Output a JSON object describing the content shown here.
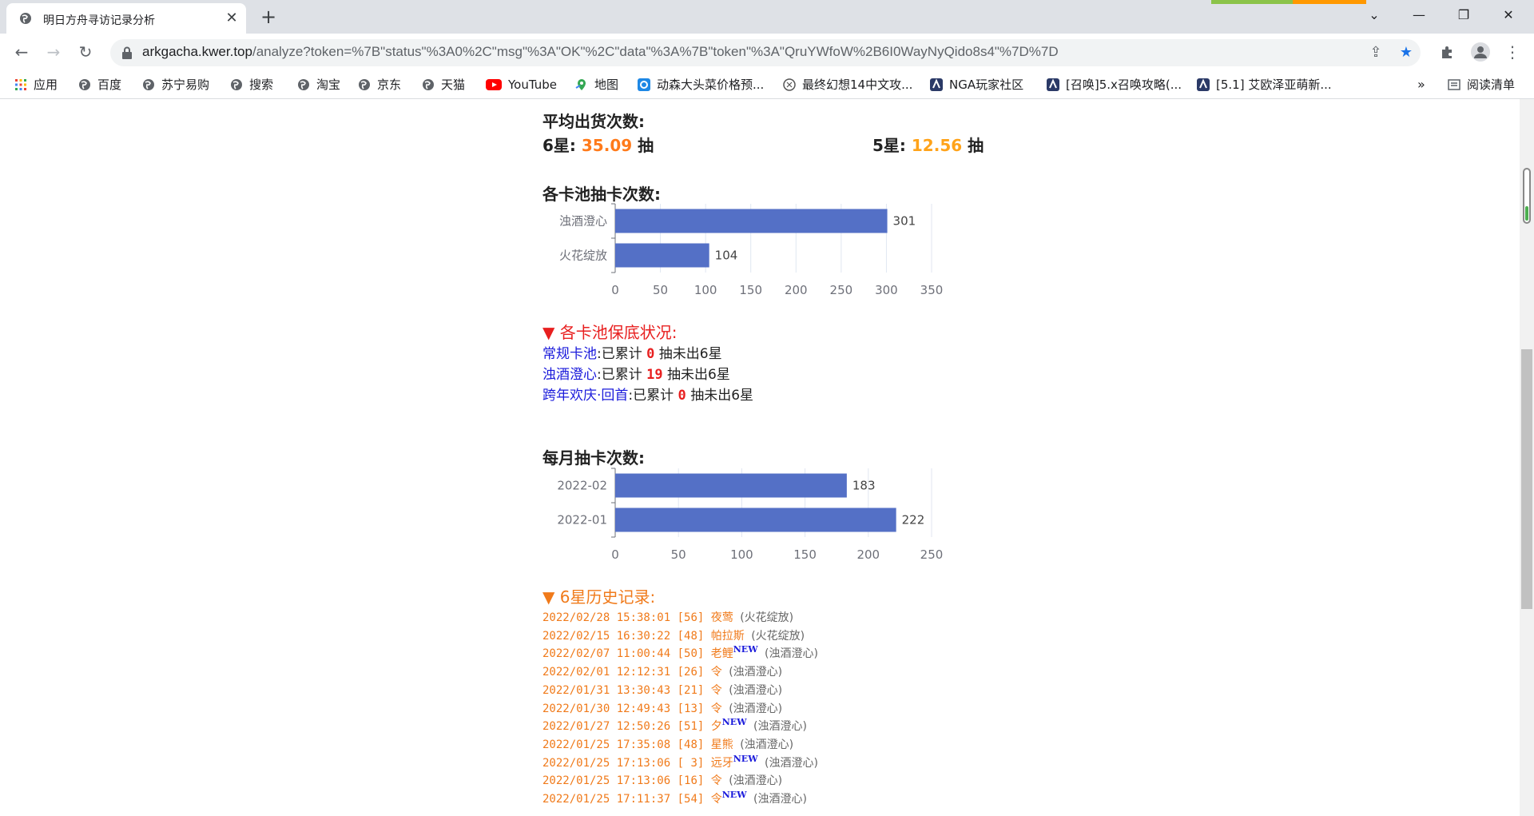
{
  "browser": {
    "tab_title": "明日方舟寻访记录分析",
    "url_host": "arkgacha.kwer.top",
    "url_rest": "/analyze?token=%7B\"status\"%3A0%2C\"msg\"%3A\"OK\"%2C\"data\"%3A%7B\"token\"%3A\"QruYWfoW%2B6I0WayNyQido8s4\"%7D%7D",
    "bookmarks": [
      {
        "label": "应用",
        "icon": "apps-grid-icon"
      },
      {
        "label": "百度",
        "icon": "globe-icon"
      },
      {
        "label": "苏宁易购",
        "icon": "globe-icon"
      },
      {
        "label": "搜索",
        "icon": "globe-icon"
      },
      {
        "label": "淘宝",
        "icon": "globe-icon"
      },
      {
        "label": "京东",
        "icon": "globe-icon"
      },
      {
        "label": "天猫",
        "icon": "globe-icon"
      },
      {
        "label": "YouTube",
        "icon": "youtube-icon"
      },
      {
        "label": "地图",
        "icon": "maps-icon"
      },
      {
        "label": "动森大头菜价格预...",
        "icon": "bookmark-icon"
      },
      {
        "label": "最终幻想14中文攻...",
        "icon": "bookmark-icon"
      },
      {
        "label": "NGA玩家社区",
        "icon": "bookmark-icon"
      },
      {
        "label": "[召唤]5.x召唤攻略(...",
        "icon": "bookmark-icon"
      },
      {
        "label": "[5.1] 艾欧泽亚萌新...",
        "icon": "bookmark-icon"
      }
    ],
    "more_bookmarks": "»",
    "reading_list": "阅读清单"
  },
  "avg": {
    "title": "平均出货次数:",
    "six_label": "6星:",
    "six_value": "35.09",
    "five_label": "5星:",
    "five_value": "12.56",
    "unit": "抽"
  },
  "pool_chart_title": "各卡池抽卡次数:",
  "month_chart_title": "每月抽卡次数:",
  "chart_data": [
    {
      "type": "bar",
      "orientation": "horizontal",
      "categories": [
        "浊酒澄心",
        "火花绽放"
      ],
      "values": [
        301,
        104
      ],
      "xlim": [
        0,
        350
      ],
      "xticks": [
        0,
        50,
        100,
        150,
        200,
        250,
        300,
        350
      ],
      "grid": true,
      "color": "#5470c6"
    },
    {
      "type": "bar",
      "orientation": "horizontal",
      "categories": [
        "2022-02",
        "2022-01"
      ],
      "values": [
        183,
        222
      ],
      "xlim": [
        0,
        250
      ],
      "xticks": [
        0,
        50,
        100,
        150,
        200,
        250
      ],
      "grid": true,
      "color": "#5470c6"
    }
  ],
  "pity": {
    "title": "▼ 各卡池保底状况:",
    "rows": [
      {
        "pool": "常规卡池",
        "prefix": ":已累计",
        "count": "0",
        "suffix": "抽未出6星"
      },
      {
        "pool": "浊酒澄心",
        "prefix": ":已累计",
        "count": "19",
        "suffix": "抽未出6星"
      },
      {
        "pool": "跨年欢庆·回首",
        "prefix": ":已累计",
        "count": "0",
        "suffix": "抽未出6星"
      }
    ]
  },
  "history": {
    "title": "▼ 6星历史记录:",
    "rows": [
      {
        "time": "2022/02/28 15:38:01",
        "pulls": "[56]",
        "op": "夜莺",
        "new": "",
        "pool": "(火花绽放)"
      },
      {
        "time": "2022/02/15 16:30:22",
        "pulls": "[48]",
        "op": "帕拉斯",
        "new": "",
        "pool": "(火花绽放)"
      },
      {
        "time": "2022/02/07 11:00:44",
        "pulls": "[50]",
        "op": "老鲤",
        "new": "NEW",
        "pool": "(浊酒澄心)"
      },
      {
        "time": "2022/02/01 12:12:31",
        "pulls": "[26]",
        "op": "令",
        "new": "",
        "pool": "(浊酒澄心)"
      },
      {
        "time": "2022/01/31 13:30:43",
        "pulls": "[21]",
        "op": "令",
        "new": "",
        "pool": "(浊酒澄心)"
      },
      {
        "time": "2022/01/30 12:49:43",
        "pulls": "[13]",
        "op": "令",
        "new": "",
        "pool": "(浊酒澄心)"
      },
      {
        "time": "2022/01/27 12:50:26",
        "pulls": "[51]",
        "op": "夕",
        "new": "NEW",
        "pool": "(浊酒澄心)"
      },
      {
        "time": "2022/01/25 17:35:08",
        "pulls": "[48]",
        "op": "星熊",
        "new": "",
        "pool": "(浊酒澄心)"
      },
      {
        "time": "2022/01/25 17:13:06",
        "pulls": "[ 3]",
        "op": "远牙",
        "new": "NEW",
        "pool": "(浊酒澄心)"
      },
      {
        "time": "2022/01/25 17:13:06",
        "pulls": "[16]",
        "op": "令",
        "new": "",
        "pool": "(浊酒澄心)"
      },
      {
        "time": "2022/01/25 17:11:37",
        "pulls": "[54]",
        "op": "令",
        "new": "NEW",
        "pool": "(浊酒澄心)"
      }
    ]
  }
}
